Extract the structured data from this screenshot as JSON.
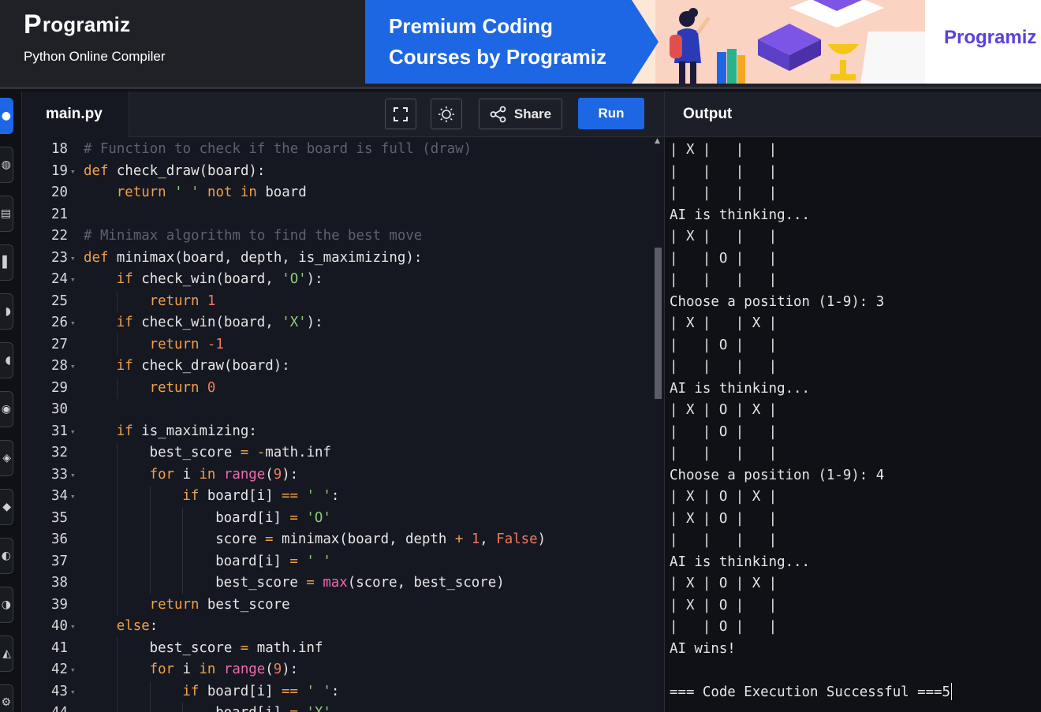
{
  "header": {
    "brand_name": "rogramiz",
    "brand_mark": "P",
    "subtitle": "Python Online Compiler"
  },
  "banner": {
    "headline_line1": "Premium Coding",
    "headline_line2": "Courses by Programiz",
    "logo_text": "rogramiz",
    "logo_mark": "P",
    "accent_color": "#1e67e4"
  },
  "editor": {
    "file_tab": "main.py",
    "share_label": "Share",
    "run_label": "Run",
    "fullscreen_icon": "fullscreen-icon",
    "theme_icon": "sun-icon",
    "share_icon": "share-icon",
    "code_lines": [
      {
        "n": "18",
        "fold": false,
        "indent": 0,
        "tokens": [
          [
            "comment",
            "# Function to check if the board is full (draw)"
          ]
        ]
      },
      {
        "n": "19",
        "fold": true,
        "indent": 0,
        "tokens": [
          [
            "keyword",
            "def"
          ],
          [
            "plain",
            " check_draw(board):"
          ]
        ]
      },
      {
        "n": "20",
        "fold": false,
        "indent": 1,
        "tokens": [
          [
            "keyword",
            "return"
          ],
          [
            "plain",
            " "
          ],
          [
            "string",
            "' '"
          ],
          [
            "plain",
            " "
          ],
          [
            "keyword",
            "not in"
          ],
          [
            "plain",
            " board"
          ]
        ]
      },
      {
        "n": "21",
        "fold": false,
        "indent": 0,
        "tokens": []
      },
      {
        "n": "22",
        "fold": false,
        "indent": 0,
        "tokens": [
          [
            "comment",
            "# Minimax algorithm to find the best move"
          ]
        ]
      },
      {
        "n": "23",
        "fold": true,
        "indent": 0,
        "tokens": [
          [
            "keyword",
            "def"
          ],
          [
            "plain",
            " minimax(board, depth, is_maximizing):"
          ]
        ]
      },
      {
        "n": "24",
        "fold": true,
        "indent": 1,
        "tokens": [
          [
            "keyword",
            "if"
          ],
          [
            "plain",
            " check_win(board, "
          ],
          [
            "string",
            "'O'"
          ],
          [
            "plain",
            "):"
          ]
        ]
      },
      {
        "n": "25",
        "fold": false,
        "indent": 2,
        "tokens": [
          [
            "keyword",
            "return"
          ],
          [
            "plain",
            " "
          ],
          [
            "number",
            "1"
          ]
        ]
      },
      {
        "n": "26",
        "fold": true,
        "indent": 1,
        "tokens": [
          [
            "keyword",
            "if"
          ],
          [
            "plain",
            " check_win(board, "
          ],
          [
            "string",
            "'X'"
          ],
          [
            "plain",
            "):"
          ]
        ]
      },
      {
        "n": "27",
        "fold": false,
        "indent": 2,
        "tokens": [
          [
            "keyword",
            "return"
          ],
          [
            "plain",
            " "
          ],
          [
            "number",
            "-1"
          ]
        ]
      },
      {
        "n": "28",
        "fold": true,
        "indent": 1,
        "tokens": [
          [
            "keyword",
            "if"
          ],
          [
            "plain",
            " check_draw(board):"
          ]
        ]
      },
      {
        "n": "29",
        "fold": false,
        "indent": 2,
        "tokens": [
          [
            "keyword",
            "return"
          ],
          [
            "plain",
            " "
          ],
          [
            "number",
            "0"
          ]
        ]
      },
      {
        "n": "30",
        "fold": false,
        "indent": 0,
        "tokens": []
      },
      {
        "n": "31",
        "fold": true,
        "indent": 1,
        "tokens": [
          [
            "keyword",
            "if"
          ],
          [
            "plain",
            " is_maximizing:"
          ]
        ]
      },
      {
        "n": "32",
        "fold": false,
        "indent": 2,
        "tokens": [
          [
            "plain",
            "best_score "
          ],
          [
            "op",
            "="
          ],
          [
            "plain",
            " "
          ],
          [
            "op",
            "-"
          ],
          [
            "plain",
            "math.inf"
          ]
        ]
      },
      {
        "n": "33",
        "fold": true,
        "indent": 2,
        "tokens": [
          [
            "keyword",
            "for"
          ],
          [
            "plain",
            " i "
          ],
          [
            "keyword",
            "in"
          ],
          [
            "plain",
            " "
          ],
          [
            "builtin",
            "range"
          ],
          [
            "plain",
            "("
          ],
          [
            "number",
            "9"
          ],
          [
            "plain",
            "):"
          ]
        ]
      },
      {
        "n": "34",
        "fold": true,
        "indent": 3,
        "tokens": [
          [
            "keyword",
            "if"
          ],
          [
            "plain",
            " board[i] "
          ],
          [
            "op",
            "=="
          ],
          [
            "plain",
            " "
          ],
          [
            "string",
            "' '"
          ],
          [
            "plain",
            ":"
          ]
        ]
      },
      {
        "n": "35",
        "fold": false,
        "indent": 4,
        "tokens": [
          [
            "plain",
            "board[i] "
          ],
          [
            "op",
            "="
          ],
          [
            "plain",
            " "
          ],
          [
            "string",
            "'O'"
          ]
        ]
      },
      {
        "n": "36",
        "fold": false,
        "indent": 4,
        "tokens": [
          [
            "plain",
            "score "
          ],
          [
            "op",
            "="
          ],
          [
            "plain",
            " minimax(board, depth "
          ],
          [
            "op",
            "+"
          ],
          [
            "plain",
            " "
          ],
          [
            "number",
            "1"
          ],
          [
            "plain",
            ", "
          ],
          [
            "bool",
            "False"
          ],
          [
            "plain",
            ")"
          ]
        ]
      },
      {
        "n": "37",
        "fold": false,
        "indent": 4,
        "tokens": [
          [
            "plain",
            "board[i] "
          ],
          [
            "op",
            "="
          ],
          [
            "plain",
            " "
          ],
          [
            "string",
            "' '"
          ]
        ]
      },
      {
        "n": "38",
        "fold": false,
        "indent": 4,
        "tokens": [
          [
            "plain",
            "best_score "
          ],
          [
            "op",
            "="
          ],
          [
            "plain",
            " "
          ],
          [
            "builtin",
            "max"
          ],
          [
            "plain",
            "(score, best_score)"
          ]
        ]
      },
      {
        "n": "39",
        "fold": false,
        "indent": 2,
        "tokens": [
          [
            "keyword",
            "return"
          ],
          [
            "plain",
            " best_score"
          ]
        ]
      },
      {
        "n": "40",
        "fold": true,
        "indent": 1,
        "tokens": [
          [
            "keyword",
            "else"
          ],
          [
            "plain",
            ":"
          ]
        ]
      },
      {
        "n": "41",
        "fold": false,
        "indent": 2,
        "tokens": [
          [
            "plain",
            "best_score "
          ],
          [
            "op",
            "="
          ],
          [
            "plain",
            " math.inf"
          ]
        ]
      },
      {
        "n": "42",
        "fold": true,
        "indent": 2,
        "tokens": [
          [
            "keyword",
            "for"
          ],
          [
            "plain",
            " i "
          ],
          [
            "keyword",
            "in"
          ],
          [
            "plain",
            " "
          ],
          [
            "builtin",
            "range"
          ],
          [
            "plain",
            "("
          ],
          [
            "number",
            "9"
          ],
          [
            "plain",
            "):"
          ]
        ]
      },
      {
        "n": "43",
        "fold": true,
        "indent": 3,
        "tokens": [
          [
            "keyword",
            "if"
          ],
          [
            "plain",
            " board[i] "
          ],
          [
            "op",
            "=="
          ],
          [
            "plain",
            " "
          ],
          [
            "string",
            "' '"
          ],
          [
            "plain",
            ":"
          ]
        ]
      },
      {
        "n": "44",
        "fold": false,
        "indent": 4,
        "tokens": [
          [
            "plain",
            "board[i] "
          ],
          [
            "op",
            "="
          ],
          [
            "plain",
            " "
          ],
          [
            "string",
            "'X'"
          ]
        ]
      }
    ]
  },
  "output": {
    "title": "Output",
    "lines": [
      "| X |   |   |",
      "|   |   |   |",
      "|   |   |   |",
      "AI is thinking...",
      "| X |   |   |",
      "|   | O |   |",
      "|   |   |   |",
      "Choose a position (1-9): 3",
      "| X |   | X |",
      "|   | O |   |",
      "|   |   |   |",
      "AI is thinking...",
      "| X | O | X |",
      "|   | O |   |",
      "|   |   |   |",
      "Choose a position (1-9): 4",
      "| X | O | X |",
      "| X | O |   |",
      "|   |   |   |",
      "AI is thinking...",
      "| X | O | X |",
      "| X | O |   |",
      "|   | O |   |",
      "AI wins!",
      "",
      "=== Code Execution Successful ===5"
    ]
  },
  "rail": {
    "icons": [
      "python-icon",
      "sql-icon",
      "html-icon",
      "java-icon",
      "c-icon",
      "cpp-icon",
      "csharp-icon",
      "js-icon",
      "golang-icon",
      "php-icon",
      "swift-icon",
      "rust-icon",
      "kotlin-icon",
      "settings-icon"
    ]
  }
}
